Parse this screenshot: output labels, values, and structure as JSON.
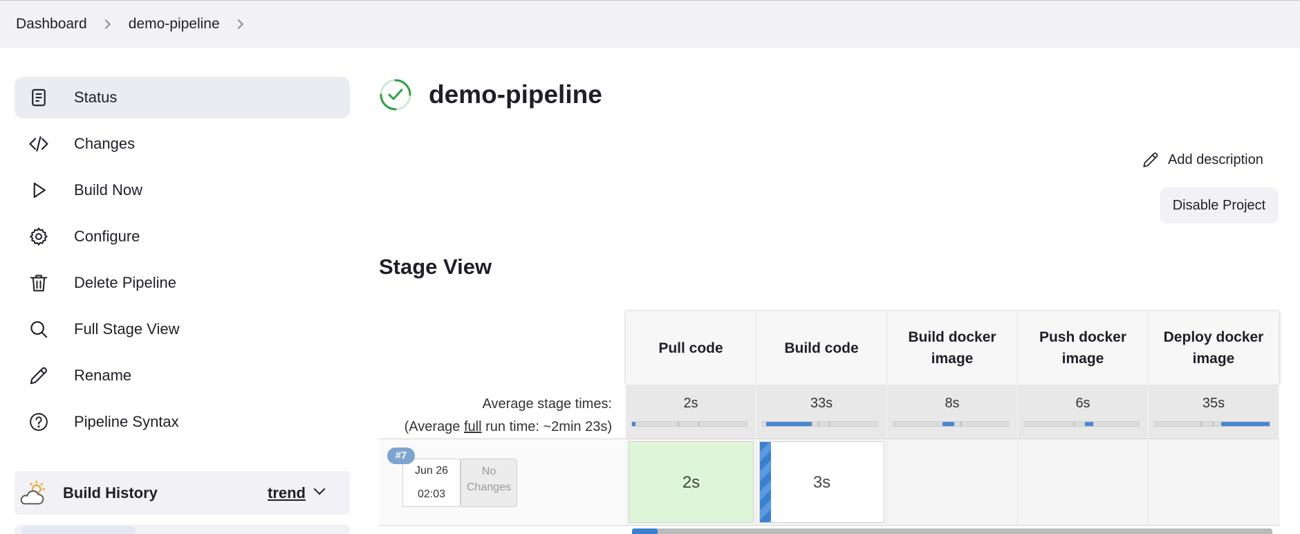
{
  "breadcrumb": {
    "items": [
      "Dashboard",
      "demo-pipeline"
    ]
  },
  "sidebar": {
    "items": [
      {
        "label": "Status",
        "icon": "status-doc-icon",
        "active": true
      },
      {
        "label": "Changes",
        "icon": "code-icon"
      },
      {
        "label": "Build Now",
        "icon": "play-icon"
      },
      {
        "label": "Configure",
        "icon": "gear-icon"
      },
      {
        "label": "Delete Pipeline",
        "icon": "trash-icon"
      },
      {
        "label": "Full Stage View",
        "icon": "search-icon"
      },
      {
        "label": "Rename",
        "icon": "pencil-icon"
      },
      {
        "label": "Pipeline Syntax",
        "icon": "help-icon"
      }
    ]
  },
  "build_history": {
    "title": "Build History",
    "trend_label": "trend"
  },
  "main": {
    "title": "demo-pipeline",
    "status": "success",
    "add_description_label": "Add description",
    "disable_project_label": "Disable Project"
  },
  "stage_view": {
    "title": "Stage View",
    "avg_label_line1": "Average stage times:",
    "avg_label_prefix": "(Average ",
    "avg_label_full": "full",
    "avg_label_suffix": " run time: ~2min 23s)",
    "stages": [
      {
        "name": "Pull code",
        "avg": "2s",
        "avg_fraction": 0.03
      },
      {
        "name": "Build code",
        "avg": "33s",
        "avg_fraction": 0.4
      },
      {
        "name": "Build docker image",
        "avg": "8s",
        "avg_fraction": 0.1
      },
      {
        "name": "Push docker image",
        "avg": "6s",
        "avg_fraction": 0.07
      },
      {
        "name": "Deploy docker image",
        "avg": "35s",
        "avg_fraction": 0.43
      }
    ],
    "runs": [
      {
        "number": "#7",
        "date": "Jun 26",
        "time": "02:03",
        "changes": "No Changes",
        "stage_results": [
          {
            "duration": "2s",
            "state": "success"
          },
          {
            "duration": "3s",
            "state": "running"
          },
          {
            "duration": "",
            "state": "pending"
          },
          {
            "duration": "",
            "state": "pending"
          },
          {
            "duration": "",
            "state": "pending"
          }
        ]
      }
    ]
  },
  "colors": {
    "success_green": "#2ea043",
    "running_blue": "#3b7fd0",
    "success_cell": "#dff5d8"
  }
}
